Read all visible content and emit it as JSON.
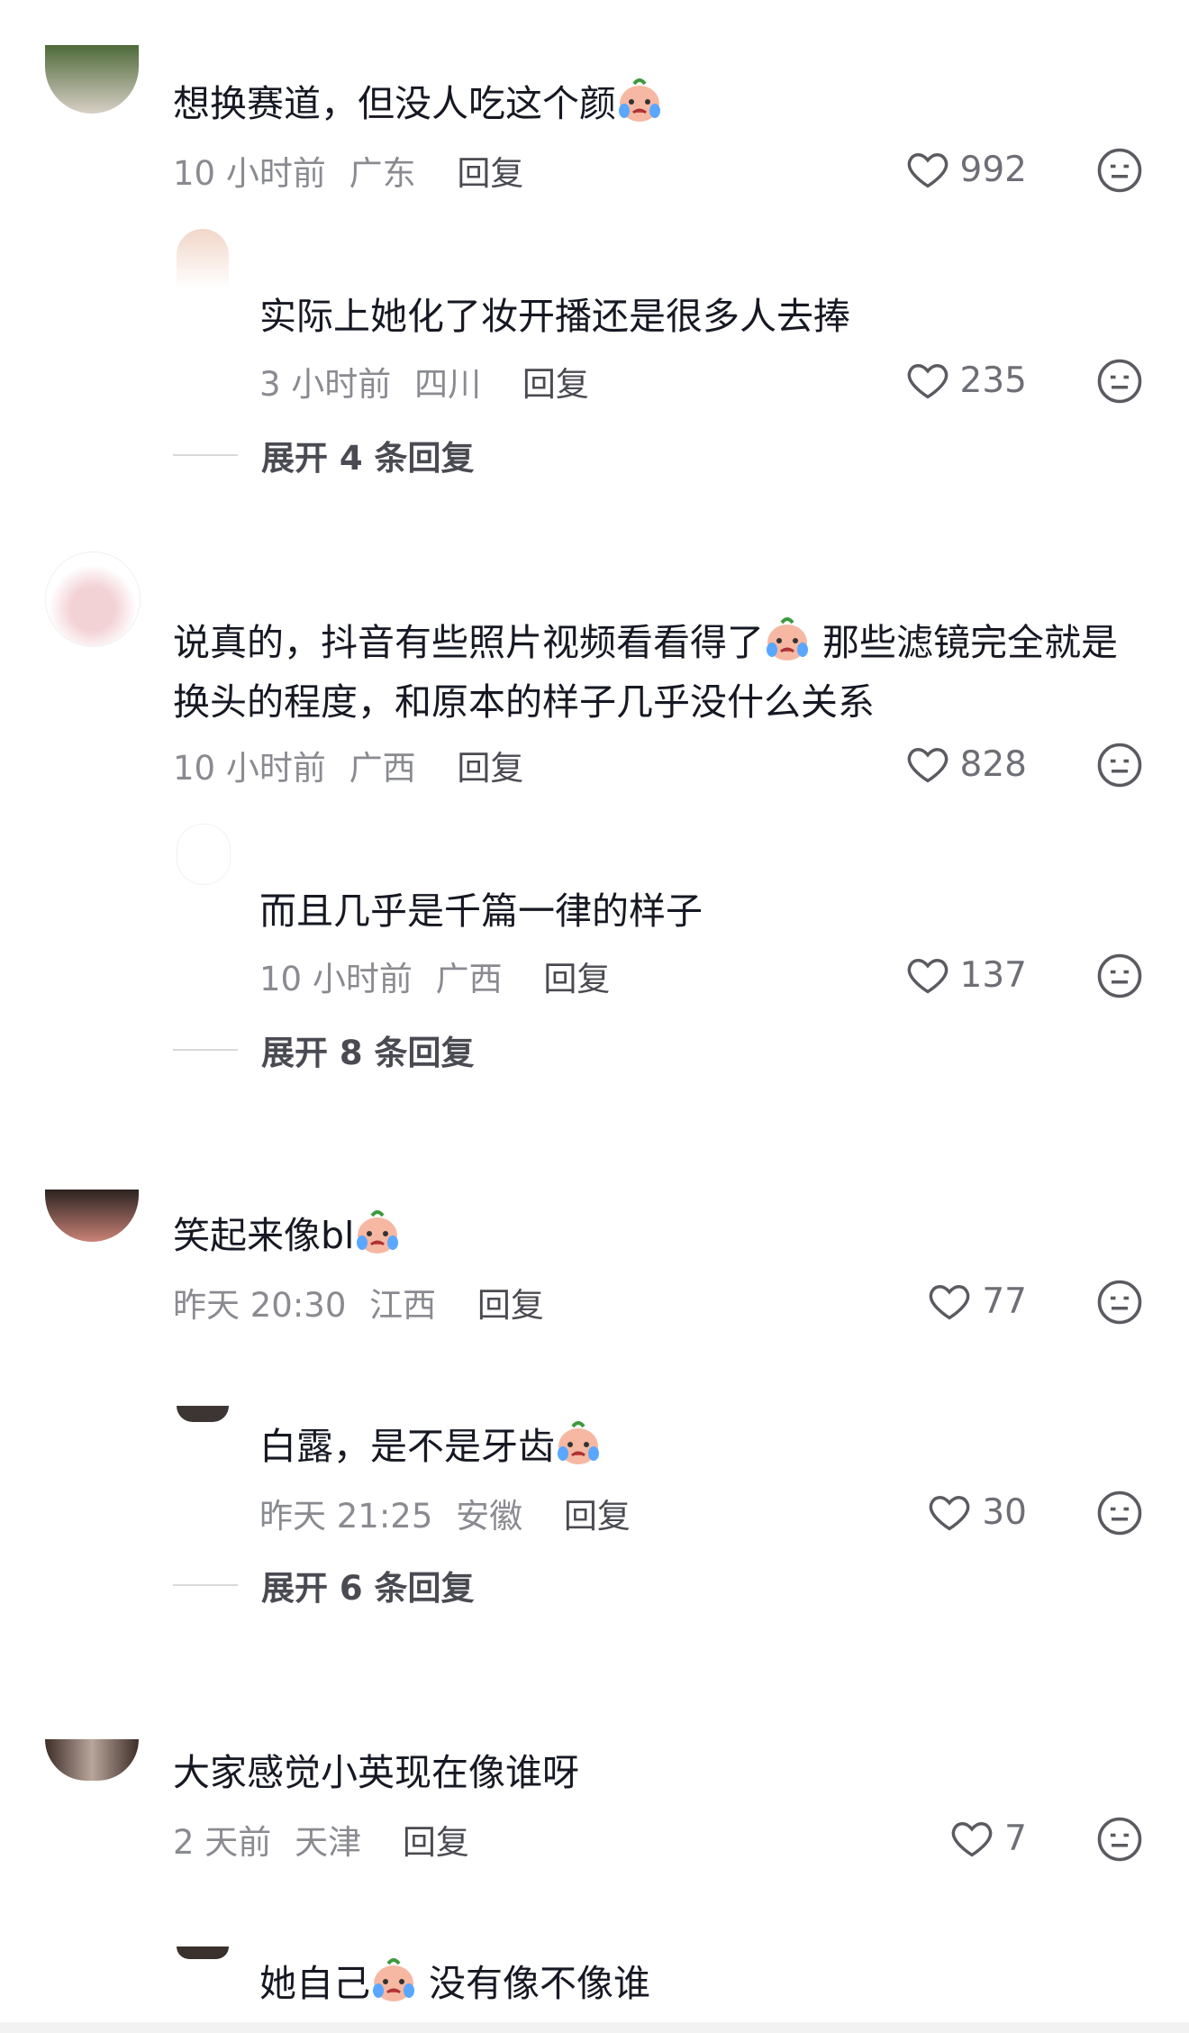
{
  "comments": [
    {
      "text_a": "想换赛道，但没人吃这个颜",
      "text_b": "",
      "time": "10 小时前",
      "region": "广东",
      "reply": "回复",
      "likes": "992"
    },
    {
      "text_a": "实际上她化了妆开播还是很多人去捧",
      "text_b": "",
      "time": "3 小时前",
      "region": "四川",
      "reply": "回复",
      "likes": "235",
      "expand": "展开 4 条回复"
    },
    {
      "text_a": "说真的，抖音有些照片视频看看得了",
      "text_b": "那些滤镜完全就是",
      "line2": "换头的程度，和原本的样子几乎没什么关系",
      "time": "10 小时前",
      "region": "广西",
      "reply": "回复",
      "likes": "828"
    },
    {
      "text_a": "而且几乎是千篇一律的样子",
      "text_b": "",
      "time": "10 小时前",
      "region": "广西",
      "reply": "回复",
      "likes": "137",
      "expand": "展开 8 条回复"
    },
    {
      "text_a": "笑起来像bl",
      "text_b": "",
      "time": "昨天 20:30",
      "region": "江西",
      "reply": "回复",
      "likes": "77"
    },
    {
      "text_a": "白露，是不是牙齿",
      "text_b": "",
      "time": "昨天 21:25",
      "region": "安徽",
      "reply": "回复",
      "likes": "30",
      "expand": "展开 6 条回复"
    },
    {
      "text_a": "大家感觉小英现在像谁呀",
      "text_b": "",
      "time": "2 天前",
      "region": "天津",
      "reply": "回复",
      "likes": "7"
    },
    {
      "text_a": "她自己",
      "text_b": "没有像不像谁"
    }
  ],
  "icons": {
    "like": "heart-outline-icon",
    "dislike": "meh-face-icon",
    "emoji": "crying-face-emoji"
  }
}
